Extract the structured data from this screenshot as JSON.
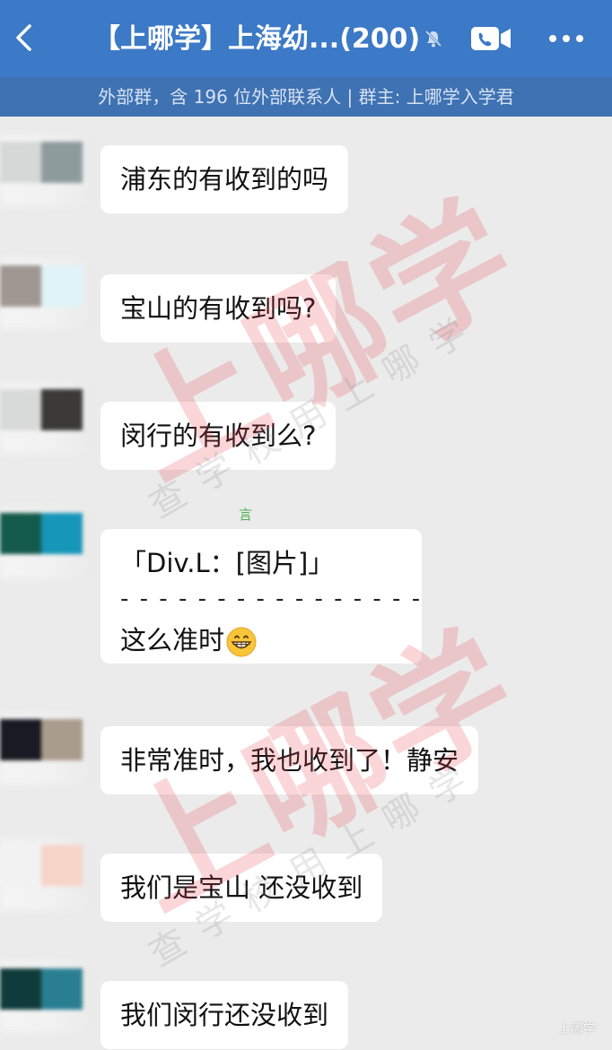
{
  "header": {
    "title": "【上哪学】上海幼...(200)",
    "subtitle": "外部群，含 196 位外部联系人 | 群主: 上哪学入学君"
  },
  "messages": [
    {
      "text": "浦东的有收到的吗"
    },
    {
      "text": "宝山的有收到吗?"
    },
    {
      "text": "闵行的有收到么?"
    },
    {
      "quote": "「Div.L：[图片]」",
      "divider": "- - - - - - - - - - - - - - - -",
      "text": "这么准时"
    },
    {
      "text": "非常准时，我也收到了！静安"
    },
    {
      "text": "我们是宝山 还没收到"
    },
    {
      "text": "我们闵行还没收到"
    }
  ],
  "watermarks": {
    "big": "上哪学",
    "small": "查学校用上哪学",
    "corner": "上哪学",
    "faint": "言"
  },
  "colors": {
    "nav_bg": "#3c79c6",
    "subbar_bg": "#3f72b2",
    "chat_bg": "#ebebeb",
    "bubble_bg": "#ffffff",
    "watermark_red": "#e64650"
  },
  "icons": {
    "back": "chevron-left-icon",
    "mute": "bell-off-icon",
    "call": "video-call-icon",
    "more": "more-dots-icon",
    "emoji": "grinning-face-emoji"
  }
}
